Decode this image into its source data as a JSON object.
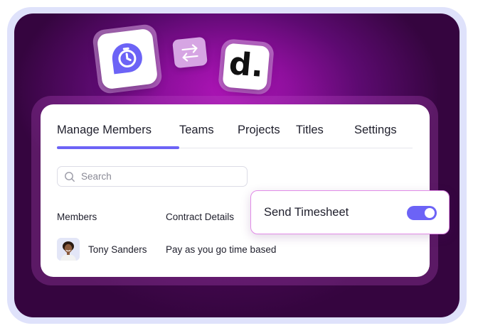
{
  "integration": {
    "timer_app_icon": "timer-bubble-icon",
    "swap_icon": "swap-arrows-icon",
    "partner_logo_letter": "d.",
    "colors": {
      "background": "#8d0f9c",
      "accent": "#6c63f6",
      "highlight_border": "#e18be7"
    }
  },
  "tabs": [
    {
      "label": "Manage Members",
      "active": true
    },
    {
      "label": "Teams",
      "active": false
    },
    {
      "label": "Projects",
      "active": false
    },
    {
      "label": "Titles",
      "active": false
    },
    {
      "label": "Settings",
      "active": false
    }
  ],
  "search": {
    "placeholder": "Search",
    "value": ""
  },
  "table": {
    "columns": [
      "Members",
      "Contract Details"
    ],
    "rows": [
      {
        "name": "Tony Sanders",
        "contract": "Pay as you go time based"
      }
    ]
  },
  "timesheet": {
    "label": "Send Timesheet",
    "enabled": true
  }
}
